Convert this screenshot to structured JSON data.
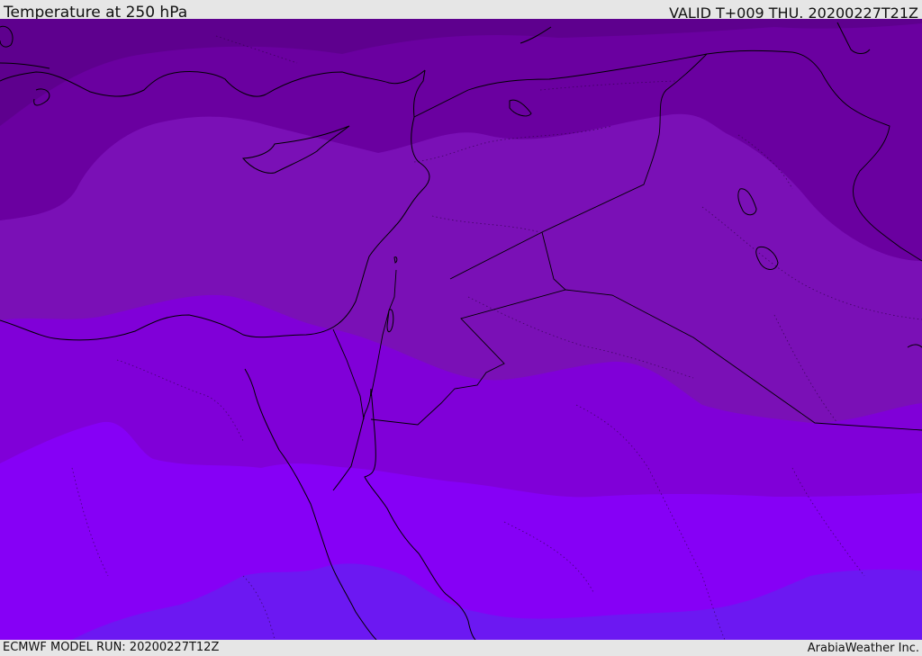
{
  "header": {
    "title": "Temperature at 250 hPa",
    "valid_time": "VALID T+009 THU. 20200227T21Z"
  },
  "footer": {
    "model_run": "ECMWF MODEL RUN: 20200227T12Z",
    "credit": "ArabiaWeather Inc."
  },
  "map": {
    "region": "Eastern Mediterranean / Middle East",
    "field": "temperature",
    "colors": {
      "band_coldest": "#5e008e",
      "band_cold": "#6a00a0",
      "band_mid": "#7a10b6",
      "band_mild": "#8000d8",
      "band_warm": "#8600f6",
      "band_warmest": "#6c18f2",
      "coastline": "#000000",
      "border": "#000000"
    }
  }
}
